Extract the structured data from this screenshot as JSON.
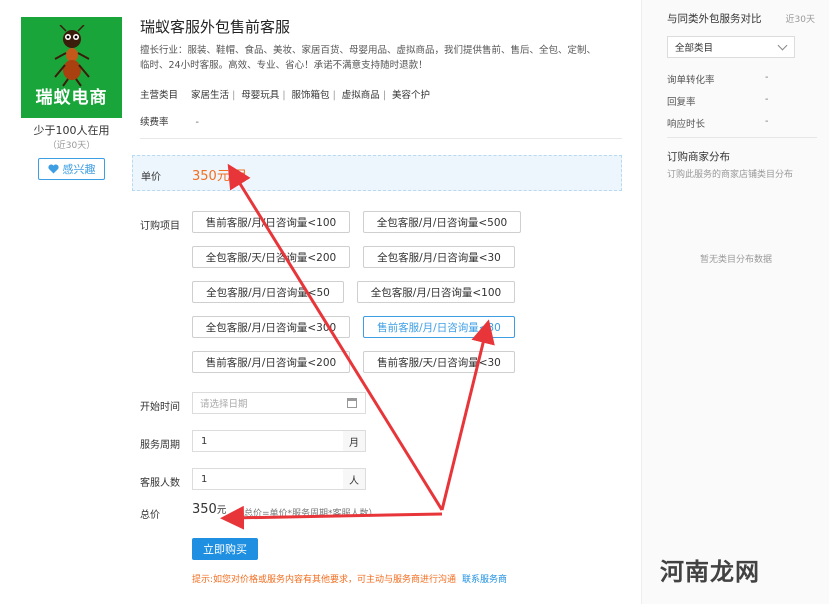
{
  "logo": {
    "text": "瑞蚁电商",
    "icon": "ant-mascot-icon",
    "bg_color": "#1aa53a"
  },
  "users": {
    "count_text": "少于100人在用",
    "period_text": "（近30天）"
  },
  "interest_button": {
    "label": "感兴趣",
    "icon": "heart-icon"
  },
  "product": {
    "title": "瑞蚁客服外包售前客服",
    "description": "擅长行业：服装、鞋帽、食品、美妆、家居百货、母婴用品、虚拟商品，我们提供售前、售后、全包、定制、临时、24小时客服。高效、专业、省心！承诺不满意支持随时退款！",
    "main_categories_label": "主营类目",
    "main_categories": [
      "家居生活",
      "母婴玩具",
      "服饰箱包",
      "虚拟商品",
      "美容个护"
    ],
    "renewal_label": "续费率",
    "renewal_value": "-"
  },
  "price": {
    "label": "单价",
    "value": "350元/月",
    "color": "#f26e21"
  },
  "options": {
    "label": "订购项目",
    "items": [
      "售前客服/月/日咨询量<100",
      "全包客服/月/日咨询量<500",
      "全包客服/天/日咨询量<200",
      "全包客服/月/日咨询量<30",
      "全包客服/月/日咨询量<50",
      "全包客服/月/日咨询量<100",
      "全包客服/月/日咨询量<300",
      "售前客服/月/日咨询量<30",
      "售前客服/月/日咨询量<200",
      "售前客服/天/日咨询量<30"
    ],
    "selected": "售前客服/月/日咨询量<30"
  },
  "form": {
    "start_label": "开始时间",
    "start_placeholder": "请选择日期",
    "period_label": "服务周期",
    "period_value": "1",
    "period_unit": "月",
    "staff_label": "客服人数",
    "staff_value": "1",
    "staff_unit": "人"
  },
  "total": {
    "label": "总价",
    "value": "350",
    "unit": "元",
    "formula": "（总价=单价*服务周期*客服人数）"
  },
  "buy_button": {
    "label": "立即购买",
    "color": "#1e8fe1"
  },
  "tip": {
    "text": "提示:如您对价格或服务内容有其他要求，可主动与服务商进行沟通",
    "link": "联系服务商"
  },
  "sidebar": {
    "title": "与同类外包服务对比",
    "period": "近30天",
    "select_value": "全部类目",
    "metrics": [
      {
        "label": "询单转化率",
        "value": "-"
      },
      {
        "label": "回复率",
        "value": "-"
      },
      {
        "label": "响应时长",
        "value": "-"
      }
    ],
    "dist_title": "订购商家分布",
    "dist_desc": "订购此服务的商家店铺类目分布",
    "empty_text": "暂无类目分布数据"
  },
  "watermark": {
    "text": "河南龙网"
  },
  "annotation": {
    "arrow_color": "#e8353a"
  }
}
